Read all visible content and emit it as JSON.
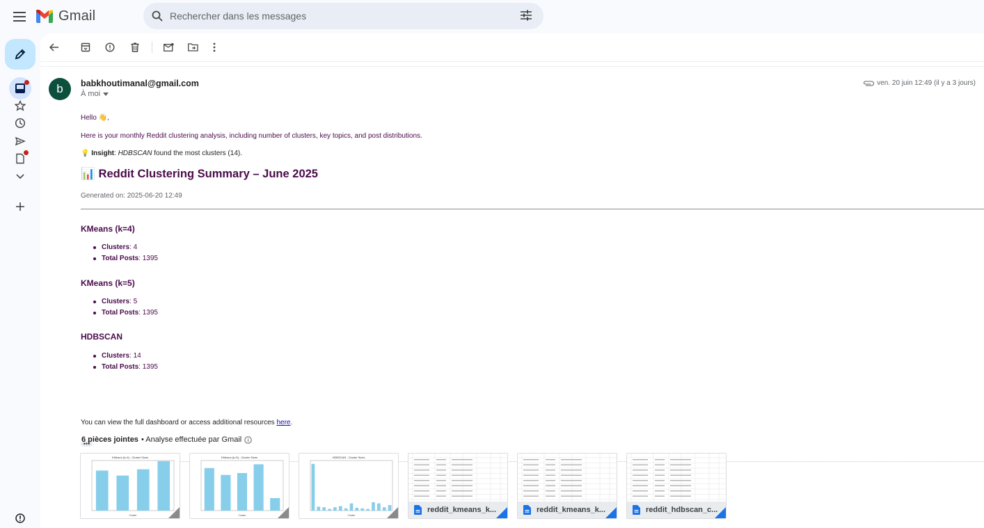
{
  "app": {
    "name": "Gmail"
  },
  "search": {
    "placeholder": "Rechercher dans les messages"
  },
  "message": {
    "sender": "babkhoutimanal@gmail.com",
    "avatar_letter": "b",
    "to": "À moi",
    "date": "ven. 20 juin 12:49 (il y a 3 jours)"
  },
  "body": {
    "greeting": "Hello 👋,",
    "intro": "Here is your monthly Reddit clustering analysis, including number of clusters, key topics, and post distributions.",
    "insight_icon": "💡",
    "insight_label": "Insight",
    "insight_method": "HDBSCAN",
    "insight_text": " found the most clusters (14).",
    "title_icon": "📊",
    "title": "Reddit Clustering Summary – June 2025",
    "generated": "Generated on: 2025-06-20 12:49",
    "sections": [
      {
        "name": "KMeans (k=4)",
        "clusters_label": "Clusters",
        "clusters": ": 4",
        "posts_label": "Total Posts",
        "posts": ": 1395"
      },
      {
        "name": "KMeans (k=5)",
        "clusters_label": "Clusters",
        "clusters": ": 5",
        "posts_label": "Total Posts",
        "posts": ": 1395"
      },
      {
        "name": "HDBSCAN",
        "clusters_label": "Clusters",
        "clusters": ": 14",
        "posts_label": "Total Posts",
        "posts": ": 1395"
      }
    ],
    "footer_text": "You can view the full dashboard or access additional resources ",
    "footer_link": "here",
    "footer_end": ".",
    "more": "•••"
  },
  "attachments": {
    "count_label": "6 pièces jointes",
    "analysis": " • Analyse effectuée par Gmail",
    "items": [
      {
        "type": "chart",
        "chart_title": "KMeans (k=4) - Cluster Sizes",
        "values": [
          320,
          280,
          330,
          395
        ],
        "ymax": 400,
        "xlabel": "Cluster"
      },
      {
        "type": "chart",
        "chart_title": "KMeans (k=5) - Cluster Sizes",
        "values": [
          340,
          285,
          300,
          370,
          100
        ],
        "ymax": 400,
        "xlabel": "Cluster"
      },
      {
        "type": "chart",
        "chart_title": "HDBSCAN - Cluster Sizes",
        "values": [
          840,
          70,
          60,
          30,
          60,
          80,
          40,
          130,
          50,
          40,
          30,
          150,
          130,
          60,
          100
        ],
        "ymax": 900,
        "xlabel": "Cluster"
      },
      {
        "type": "sheet",
        "filename": "reddit_kmeans_k..."
      },
      {
        "type": "sheet",
        "filename": "reddit_kmeans_k..."
      },
      {
        "type": "sheet",
        "filename": "reddit_hdbscan_c..."
      }
    ]
  },
  "colors": {
    "bar": "#87ceeb",
    "accent": "#4a0a4a",
    "compose": "#c2e7ff"
  }
}
